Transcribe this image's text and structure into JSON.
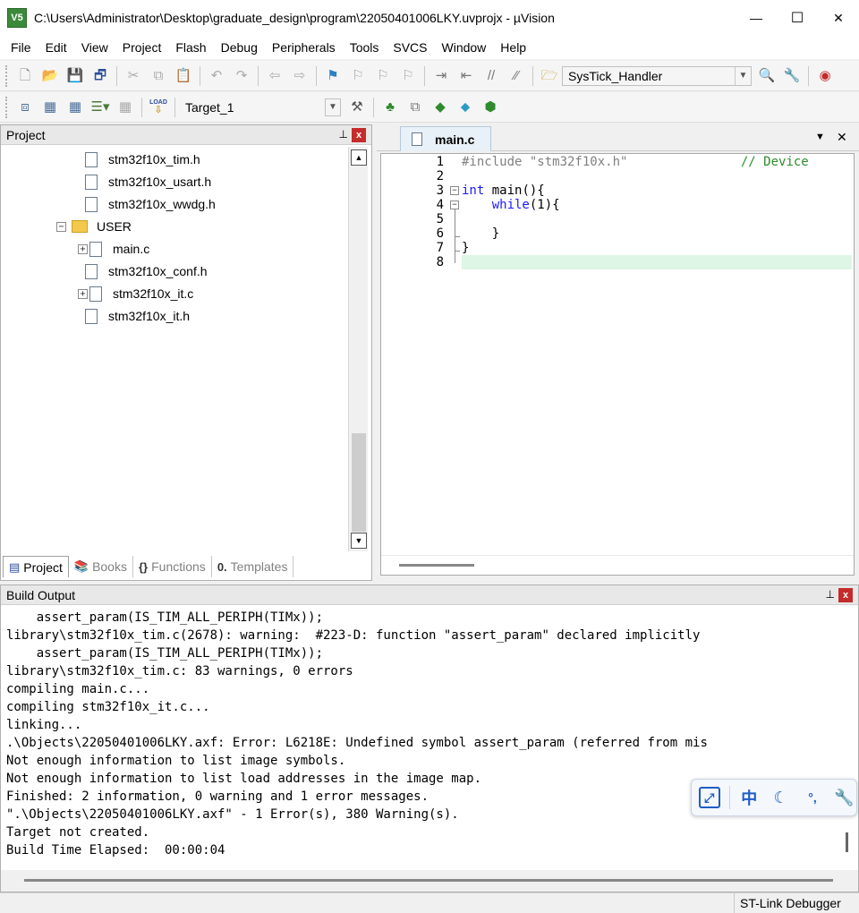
{
  "window": {
    "title": "C:\\Users\\Administrator\\Desktop\\graduate_design\\program\\22050401006LKY.uvprojx - µVision",
    "logo_text": "V5",
    "minimize_glyph": "—",
    "maximize_glyph": "☐",
    "close_glyph": "✕"
  },
  "menu": [
    "File",
    "Edit",
    "View",
    "Project",
    "Flash",
    "Debug",
    "Peripherals",
    "Tools",
    "SVCS",
    "Window",
    "Help"
  ],
  "toolbar1": {
    "function_combo": "SysTick_Handler"
  },
  "toolbar2": {
    "target_combo": "Target_1",
    "load_label": "LOAD"
  },
  "project_pane": {
    "title": "Project",
    "pin_glyph": "📌",
    "close_glyph": "x",
    "tree": [
      {
        "label": "stm32f10x_tim.h",
        "type": "file",
        "expander": ""
      },
      {
        "label": "stm32f10x_usart.h",
        "type": "file",
        "expander": ""
      },
      {
        "label": "stm32f10x_wwdg.h",
        "type": "file",
        "expander": ""
      },
      {
        "label": "USER",
        "type": "folder",
        "expander": "−"
      },
      {
        "label": "main.c",
        "type": "file",
        "expander": "+"
      },
      {
        "label": "stm32f10x_conf.h",
        "type": "file",
        "expander": ""
      },
      {
        "label": "stm32f10x_it.c",
        "type": "file",
        "expander": "+"
      },
      {
        "label": "stm32f10x_it.h",
        "type": "file",
        "expander": ""
      }
    ],
    "tabs": [
      {
        "label": "Project",
        "icon": "project-icon"
      },
      {
        "label": "Books",
        "icon": "books-icon"
      },
      {
        "label": "Functions",
        "icon": "functions-icon"
      },
      {
        "label": "Templates",
        "icon": "templates-icon"
      }
    ]
  },
  "editor": {
    "tab_label": "main.c",
    "dropdown_glyph": "▼",
    "close_glyph": "✕",
    "line_numbers": [
      "1",
      "2",
      "3",
      "4",
      "5",
      "6",
      "7",
      "8"
    ],
    "lines": [
      {
        "segments": [
          {
            "t": "#include \"stm32f10x.h\"",
            "c": "#808080"
          },
          {
            "t": "               // Device",
            "c": "#2e8b2e"
          }
        ]
      },
      {
        "segments": []
      },
      {
        "segments": [
          {
            "t": "int",
            "c": "#1a1aff"
          },
          {
            "t": " main(){",
            "c": "#000000"
          }
        ]
      },
      {
        "segments": [
          {
            "t": "    ",
            "c": "#000000"
          },
          {
            "t": "while",
            "c": "#1a1aff"
          },
          {
            "t": "(1){",
            "c": "#000000"
          }
        ]
      },
      {
        "segments": []
      },
      {
        "segments": [
          {
            "t": "    }",
            "c": "#000000"
          }
        ]
      },
      {
        "segments": [
          {
            "t": "}",
            "c": "#000000"
          }
        ]
      },
      {
        "segments": []
      }
    ]
  },
  "build_output": {
    "title": "Build Output",
    "lines": [
      "    assert_param(IS_TIM_ALL_PERIPH(TIMx));",
      "library\\stm32f10x_tim.c(2678): warning:  #223-D: function \"assert_param\" declared implicitly",
      "    assert_param(IS_TIM_ALL_PERIPH(TIMx));",
      "library\\stm32f10x_tim.c: 83 warnings, 0 errors",
      "compiling main.c...",
      "compiling stm32f10x_it.c...",
      "linking...",
      ".\\Objects\\22050401006LKY.axf: Error: L6218E: Undefined symbol assert_param (referred from mis",
      "Not enough information to list image symbols.",
      "Not enough information to list load addresses in the image map.",
      "Finished: 2 information, 0 warning and 1 error messages.",
      "\".\\Objects\\22050401006LKY.axf\" - 1 Error(s), 380 Warning(s).",
      "Target not created.",
      "Build Time Elapsed:  00:00:04"
    ]
  },
  "ime": {
    "lang_label": "中"
  },
  "status": {
    "debugger": "ST-Link Debugger"
  }
}
